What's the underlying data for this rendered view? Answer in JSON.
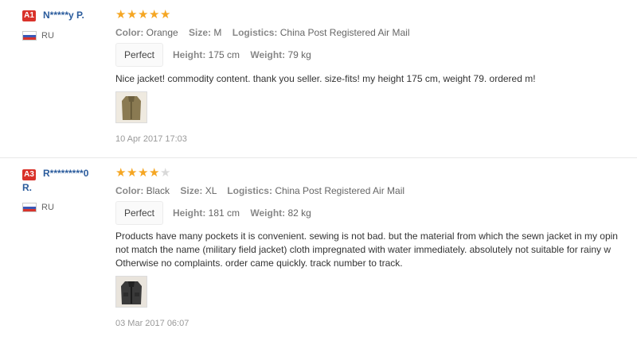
{
  "reviews": [
    {
      "badge": "A1",
      "username": "N*****y P.",
      "country": "RU",
      "stars": 5,
      "max_stars": 5,
      "color_label": "Color:",
      "color_value": "Orange",
      "size_label": "Size:",
      "size_value": "M",
      "logistics_label": "Logistics:",
      "logistics_value": "China Post Registered Air Mail",
      "fit": "Perfect",
      "height_label": "Height:",
      "height_value": "175 cm",
      "weight_label": "Weight:",
      "weight_value": "79 kg",
      "content": [
        "Nice jacket! commodity content. thank you seller. size-fits! my height 175 cm, weight 79. ordered m!"
      ],
      "date": "10 Apr 2017 17:03"
    },
    {
      "badge": "A3",
      "username_line1": "R*********0",
      "username_line2": "R.",
      "country": "RU",
      "stars": 4,
      "max_stars": 5,
      "color_label": "Color:",
      "color_value": "Black",
      "size_label": "Size:",
      "size_value": "XL",
      "logistics_label": "Logistics:",
      "logistics_value": "China Post Registered Air Mail",
      "fit": "Perfect",
      "height_label": "Height:",
      "height_value": "181 cm",
      "weight_label": "Weight:",
      "weight_value": "82 kg",
      "content": [
        "Products have many pockets it is convenient. sewing is not bad. but the material from which the sewn jacket in my opin",
        "not match the name (military field jacket) cloth impregnated with water immediately. absolutely not suitable for rainy w",
        "Otherwise no complaints. order came quickly. track number to track."
      ],
      "date": "03 Mar 2017 06:07"
    }
  ],
  "icons": {
    "flag": "russia-flag-icon",
    "star": "star-icon",
    "photo": "jacket-photo-thumbnail"
  },
  "colors": {
    "accent_star": "#f5a623",
    "badge_red": "#d9322a",
    "username_blue": "#2a5b9c"
  }
}
